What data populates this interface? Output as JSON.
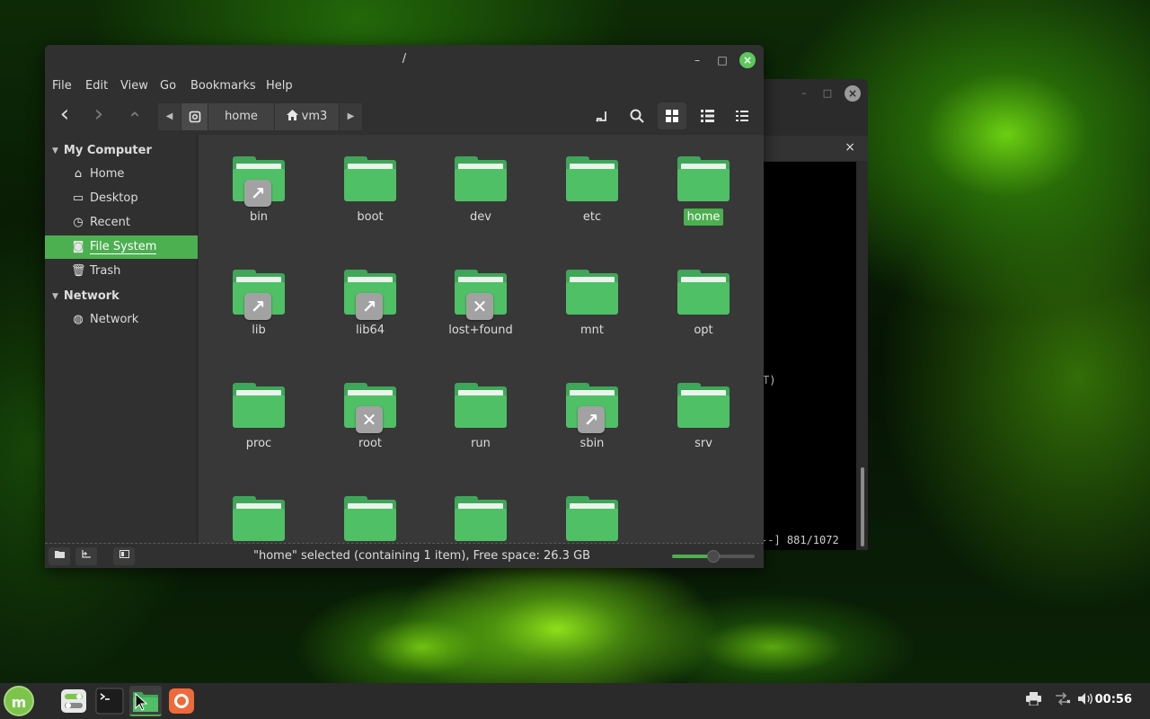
{
  "terminal": {
    "line1": "T)",
    "line2": "--] 881/1072",
    "tab_close": "×",
    "close": "×",
    "minimize": "–",
    "maximize": "□"
  },
  "window": {
    "title": "/",
    "minimize": "–",
    "maximize": "□",
    "close": "×"
  },
  "menu": [
    "File",
    "Edit",
    "View",
    "Go",
    "Bookmarks",
    "Help"
  ],
  "toolbar": {
    "back": "‹",
    "forward": "›",
    "up": "⌃",
    "path_left": "◀",
    "path_right": "▶",
    "crumbs": [
      "home",
      "vm3"
    ],
    "search_icon": "search-icon",
    "icon_view": "▦",
    "list_view": "☰",
    "compact_view": "⁝⁝"
  },
  "sidebar": {
    "my_computer": "My Computer",
    "items": [
      {
        "label": "Home",
        "icon": "⌂"
      },
      {
        "label": "Desktop",
        "icon": "▭"
      },
      {
        "label": "Recent",
        "icon": "◷"
      },
      {
        "label": "File System",
        "icon": "◙"
      },
      {
        "label": "Trash",
        "icon": "🗑"
      }
    ],
    "network_head": "Network",
    "network_items": [
      {
        "label": "Network",
        "icon": "◍"
      }
    ]
  },
  "folders": [
    {
      "name": "bin",
      "emblem": "↗"
    },
    {
      "name": "boot",
      "emblem": ""
    },
    {
      "name": "dev",
      "emblem": ""
    },
    {
      "name": "etc",
      "emblem": ""
    },
    {
      "name": "home",
      "emblem": ""
    },
    {
      "name": "lib",
      "emblem": "↗"
    },
    {
      "name": "lib64",
      "emblem": "↗"
    },
    {
      "name": "lost+found",
      "emblem": "✕"
    },
    {
      "name": "mnt",
      "emblem": ""
    },
    {
      "name": "opt",
      "emblem": ""
    },
    {
      "name": "proc",
      "emblem": ""
    },
    {
      "name": "root",
      "emblem": "✕"
    },
    {
      "name": "run",
      "emblem": ""
    },
    {
      "name": "sbin",
      "emblem": "↗"
    },
    {
      "name": "srv",
      "emblem": ""
    },
    {
      "name": "",
      "emblem": ""
    },
    {
      "name": "",
      "emblem": ""
    },
    {
      "name": "",
      "emblem": ""
    },
    {
      "name": "",
      "emblem": ""
    }
  ],
  "selected_folder": "home",
  "status": {
    "text": "\"home\" selected (containing 1 item), Free space: 26.3 GB",
    "zoom_level": 0.5
  },
  "taskbar": {
    "clock": "00:56",
    "mint_logo": "m"
  },
  "colors": {
    "accent": "#4caf50",
    "folder": "#4fc065"
  }
}
